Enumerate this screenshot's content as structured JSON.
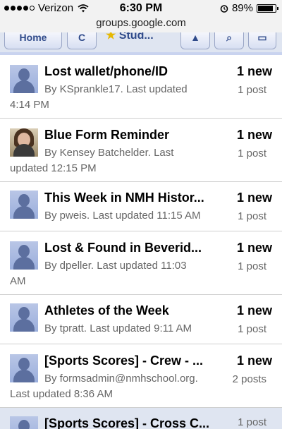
{
  "status": {
    "carrier": "Verizon",
    "time": "6:30 PM",
    "battery": "89%"
  },
  "url": "groups.google.com",
  "toolbar": {
    "home_label": "Home",
    "group_label": "Stud..."
  },
  "topics": [
    {
      "title": "Lost wallet/phone/ID",
      "count": "1 new",
      "posts": "1 post",
      "meta": "By KSprankle17. Last updated 4:14 PM",
      "avatar": "default"
    },
    {
      "title": "Blue Form Reminder",
      "count": "1 new",
      "posts": "1 post",
      "meta": "By Kensey Batchelder. Last updated 12:15 PM",
      "avatar": "photo"
    },
    {
      "title": "This Week in NMH Histor...",
      "count": "1 new",
      "posts": "1 post",
      "meta": "By pweis. Last updated 11:15 AM",
      "avatar": "default"
    },
    {
      "title": "Lost & Found in Beverid...",
      "count": "1 new",
      "posts": "1 post",
      "meta": "By dpeller. Last updated 11:03 AM",
      "avatar": "default"
    },
    {
      "title": "Athletes of the Week",
      "count": "1 new",
      "posts": "1 post",
      "meta": "By tpratt. Last updated 9:11 AM",
      "avatar": "default"
    },
    {
      "title": "[Sports Scores] - Crew - ...",
      "count": "1 new",
      "posts": "2 posts",
      "meta": "By formsadmin@nmhschool.org. Last updated 8:36 AM",
      "avatar": "default"
    },
    {
      "title": "[Sports Scores] - Cross C...",
      "count": "",
      "posts": "1 post",
      "meta": "",
      "avatar": "default"
    }
  ]
}
